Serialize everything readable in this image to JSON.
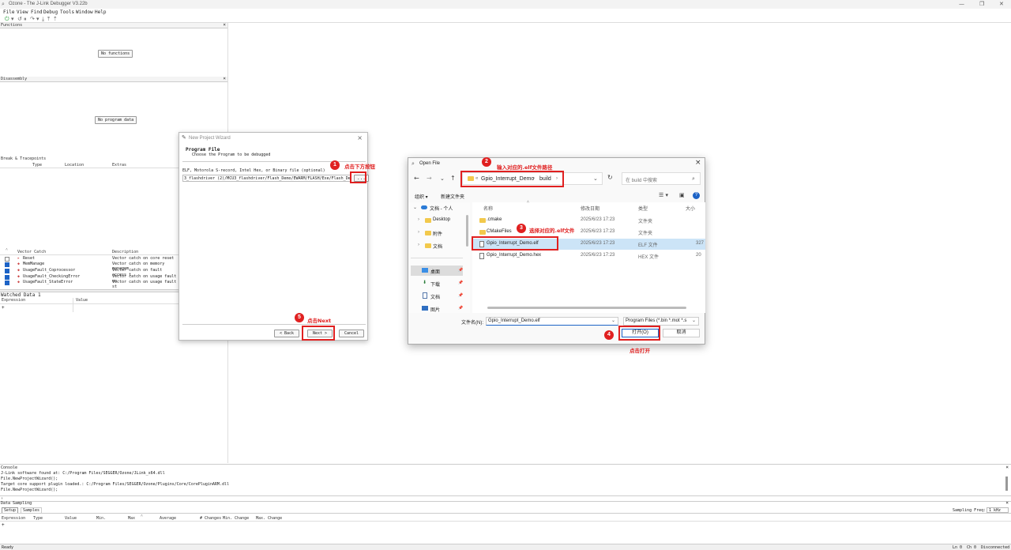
{
  "window": {
    "title": "Ozone - The J-Link Debugger V3.22b",
    "controls": [
      "—",
      "❐",
      "✕"
    ]
  },
  "menu": [
    "File",
    "View",
    "Find",
    "Debug",
    "Tools",
    "Window",
    "Help"
  ],
  "panels": {
    "functions": {
      "title": "Functions",
      "placeholder": "No functions"
    },
    "disassembly": {
      "title": "Disassembly",
      "placeholder": "No program data"
    },
    "breakpoints": {
      "title": "Break & Tracepoints",
      "columns": [
        "Type",
        "Location",
        "Extras"
      ]
    },
    "vector_catch": {
      "columns": [
        "Vector Catch",
        "Description"
      ],
      "rows": [
        {
          "name": "Reset",
          "desc": "Vector catch on core reset",
          "checked": false
        },
        {
          "name": "MemManage",
          "desc": "Vector catch on memory managem",
          "checked": true
        },
        {
          "name": "UsageFault_Coprocessor",
          "desc": "Vector catch on fault access t",
          "checked": true
        },
        {
          "name": "UsageFault_CheckingError",
          "desc": "Vector catch on usage fault en",
          "checked": true
        },
        {
          "name": "UsageFault_StateError",
          "desc": "Vector catch on usage fault st",
          "checked": true
        }
      ]
    },
    "watched": {
      "title": "Watched Data 1",
      "columns": [
        "Expression",
        "Value"
      ]
    }
  },
  "wizard": {
    "title": "New Project Wizard",
    "heading": "Program File",
    "subheading": "Choose the Program to be debugged",
    "field_label": "ELF, Motorola S-record, Intel Hex, or Binary file (optional)",
    "path_value": "3_flashdriver (2)/MCU3_flashdriver/Flash_Demo/EWARM/FLASH/Exe/Flash_Demo.out",
    "browse": "...",
    "back": "< Back",
    "next": "Next >",
    "cancel": "Cancel"
  },
  "open_file": {
    "title": "Open File",
    "breadcrumb": [
      "Gpio_Interrupt_Demo",
      "build"
    ],
    "search_placeholder": "在 build 中搜索",
    "organize": "组织 ▾",
    "new_folder": "新建文件夹",
    "columns": [
      "名称",
      "修改日期",
      "类型",
      "大小"
    ],
    "tree": [
      "文档 - 个人",
      "Desktop",
      "附件",
      "文档"
    ],
    "quick": [
      "桌面",
      "下载",
      "文档",
      "图片"
    ],
    "files": [
      {
        "name": ".cmake",
        "date": "2025/6/23 17:23",
        "type": "文件夹",
        "size": "",
        "kind": "folder"
      },
      {
        "name": "CMakeFiles",
        "date": "2025/6/23 17:23",
        "type": "文件夹",
        "size": "",
        "kind": "folder"
      },
      {
        "name": "Gpio_Interrupt_Demo.elf",
        "date": "2025/6/23 17:23",
        "type": "ELF 文件",
        "size": "327",
        "kind": "file"
      },
      {
        "name": "Gpio_Interrupt_Demo.hex",
        "date": "2025/6/23 17:23",
        "type": "HEX 文件",
        "size": "20",
        "kind": "file"
      }
    ],
    "filename_label": "文件名(N):",
    "filename_value": "Gpio_Interrupt_Demo.elf",
    "filetype": "Program Files (*.bin *.mot *.s",
    "open": "打开(O)",
    "cancel": "取消"
  },
  "annotations": {
    "a1": {
      "num": "1",
      "text": "点击下方按钮"
    },
    "a2": {
      "num": "2",
      "text": "输入对应的.elf文件路径"
    },
    "a3": {
      "num": "3",
      "text": "选择对应的.elf文件"
    },
    "a4": {
      "num": "4",
      "text": "点击打开"
    },
    "a5": {
      "num": "5",
      "text": "点击Next"
    }
  },
  "console": {
    "title": "Console",
    "lines": [
      "J-Link software found at: C:/Program Files/SEGGER/Ozone/JLink_x64.dll",
      "File.NewProjectWizard();",
      "Target core support plugin loaded.: C:/Program Files/SEGGER/Ozone/Plugins/Core/CorePluginARM.dll",
      "File.NewProjectWizard();"
    ]
  },
  "data_sampling": {
    "title": "Data Sampling",
    "tabs": [
      "Setup",
      "Samples"
    ],
    "freq_label": "Sampling Freq:",
    "freq_value": "1 kHz",
    "columns": [
      "Expression",
      "Type",
      "Value",
      "Min.",
      "Max",
      "Average",
      "# Changes",
      "Min. Change",
      "Max. Change"
    ]
  },
  "status": {
    "left": "Ready",
    "ln": "Ln 0",
    "ch": "Ch 0",
    "conn": "Disconnected"
  }
}
